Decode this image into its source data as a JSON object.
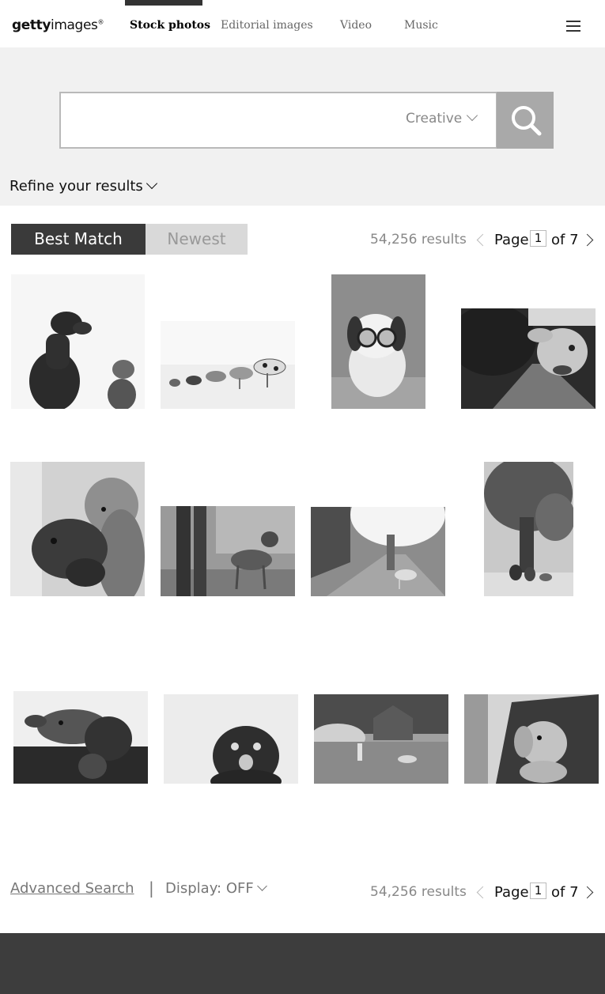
{
  "brand": {
    "logo_bold": "getty",
    "logo_rest": "images",
    "logo_mark": "®"
  },
  "nav": {
    "tabs": [
      {
        "label": "Stock photos",
        "active": true
      },
      {
        "label": "Editorial images",
        "active": false
      },
      {
        "label": "Video",
        "active": false
      },
      {
        "label": "Music",
        "active": false
      }
    ],
    "menu_icon": "hamburger-icon"
  },
  "search": {
    "query": "",
    "placeholder": "",
    "scope": "Creative",
    "button_icon": "search-icon"
  },
  "refine": {
    "label": "Refine your results"
  },
  "sort": {
    "best_match": "Best Match",
    "newest": "Newest",
    "selected": "Best Match"
  },
  "results": {
    "count": "54,256 results",
    "page_label": "Page",
    "page": "1",
    "of_label": "of 7"
  },
  "images": [
    {
      "subject": "labrador and yorkshire terrier looking up"
    },
    {
      "subject": "row of dogs from small to large"
    },
    {
      "subject": "shih tzu puppy wearing glasses"
    },
    {
      "subject": "dog head out of car window on road"
    },
    {
      "subject": "cat leaning on dachshund"
    },
    {
      "subject": "dog on leash on city sidewalk"
    },
    {
      "subject": "woman walking dog on sunny street"
    },
    {
      "subject": "people sitting under large tree with dog"
    },
    {
      "subject": "dog with ears blowing in car window"
    },
    {
      "subject": "pug licking nose"
    },
    {
      "subject": "person and dog running in yard by barn"
    },
    {
      "subject": "golden retriever in car window"
    }
  ],
  "footer_bar": {
    "advanced_search": "Advanced Search",
    "separator": "|",
    "display_label": "Display: OFF"
  },
  "colors": {
    "sort_active": "#3a3a3a",
    "sort_inactive": "#d9d9d9",
    "band": "#f1f1f1",
    "footer": "#3d3d3d"
  }
}
